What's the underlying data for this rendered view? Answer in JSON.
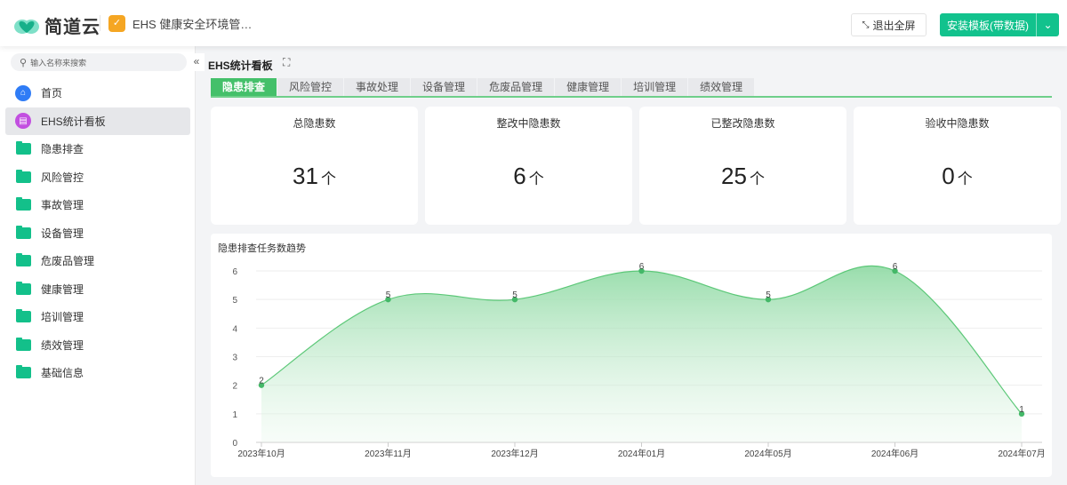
{
  "header": {
    "brand": "简道云",
    "app_name": "EHS 健康安全环境管…",
    "exit_fullscreen": "退出全屏",
    "install_button": "安装模板(带数据)"
  },
  "sidebar": {
    "search_placeholder": "输入名称来搜索",
    "collapse": "«",
    "items": [
      {
        "label": "首页",
        "icon": "home-icon"
      },
      {
        "label": "EHS统计看板",
        "icon": "dashboard-icon",
        "active": true
      },
      {
        "label": "隐患排查",
        "icon": "folder-icon"
      },
      {
        "label": "风险管控",
        "icon": "folder-icon"
      },
      {
        "label": "事故管理",
        "icon": "folder-icon"
      },
      {
        "label": "设备管理",
        "icon": "folder-icon"
      },
      {
        "label": "危废品管理",
        "icon": "folder-icon"
      },
      {
        "label": "健康管理",
        "icon": "folder-icon"
      },
      {
        "label": "培训管理",
        "icon": "folder-icon"
      },
      {
        "label": "绩效管理",
        "icon": "folder-icon"
      },
      {
        "label": "基础信息",
        "icon": "folder-icon"
      }
    ]
  },
  "page": {
    "title": "EHS统计看板"
  },
  "tabs": [
    "隐患排查",
    "风险管控",
    "事故处理",
    "设备管理",
    "危废品管理",
    "健康管理",
    "培训管理",
    "绩效管理"
  ],
  "cards": [
    {
      "label": "总隐患数",
      "value": "31",
      "unit": "个"
    },
    {
      "label": "整改中隐患数",
      "value": "6",
      "unit": "个"
    },
    {
      "label": "已整改隐患数",
      "value": "25",
      "unit": "个"
    },
    {
      "label": "验收中隐患数",
      "value": "0",
      "unit": "个"
    }
  ],
  "colors": {
    "accent": "#12c28d",
    "tab_active": "#44c06a",
    "line": "#5cc878"
  },
  "chart_data": {
    "type": "area",
    "title": "隐患排查任务数趋势",
    "categories": [
      "2023年10月",
      "2023年11月",
      "2023年12月",
      "2024年01月",
      "2024年05月",
      "2024年06月",
      "2024年07月"
    ],
    "values": [
      2,
      5,
      5,
      6,
      5,
      6,
      1
    ],
    "ylim": [
      0,
      6
    ],
    "yticks": [
      0,
      1,
      2,
      3,
      4,
      5,
      6
    ],
    "grid": true
  }
}
